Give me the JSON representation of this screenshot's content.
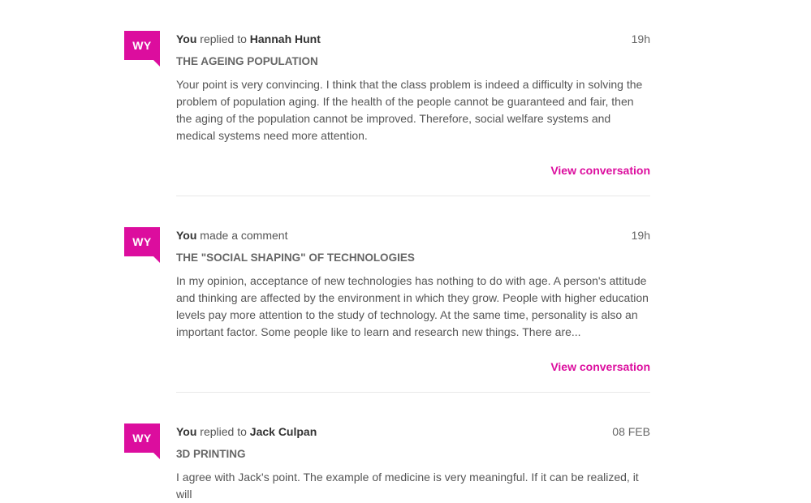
{
  "accent_color": "#dc0d9e",
  "activities": [
    {
      "avatar_initials": "WY",
      "actor": "You",
      "action": "replied to",
      "target": "Hannah Hunt",
      "time": "19h",
      "topic": "THE AGEING POPULATION",
      "text": "Your point is very convincing. I think that the class problem is indeed a difficulty in solving the problem of population aging. If the health of the people cannot be guaranteed and fair, then the aging of the population cannot be improved. Therefore, social welfare systems and medical systems need more attention.",
      "link_label": "View conversation"
    },
    {
      "avatar_initials": "WY",
      "actor": "You",
      "action": "made a comment",
      "target": "",
      "time": "19h",
      "topic": "THE \"SOCIAL SHAPING\" OF TECHNOLOGIES",
      "text": "In my opinion, acceptance of new technologies has nothing to do with age. A person's attitude and thinking are affected by the environment in which they grow. People with higher education levels pay more attention to the study of technology. At the same time, personality is also an important factor. Some people like to learn and research new things. There are...",
      "link_label": "View conversation"
    },
    {
      "avatar_initials": "WY",
      "actor": "You",
      "action": "replied to",
      "target": "Jack Culpan",
      "time": "08 FEB",
      "topic": "3D PRINTING",
      "text": "I agree with Jack's point. The example of medicine is very meaningful. If it can be realized, it will",
      "link_label": ""
    }
  ]
}
